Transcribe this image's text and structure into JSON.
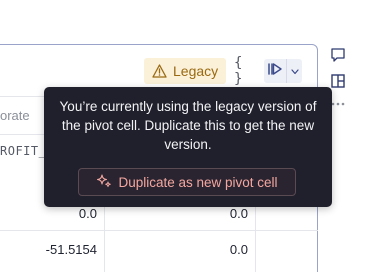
{
  "toolbar": {
    "legacy_label": "Legacy",
    "braces_label": "{ }",
    "icons": {
      "warning": "warning-triangle-icon",
      "braces": "braces-icon",
      "run": "run-icon",
      "chevron": "chevron-down-icon"
    }
  },
  "rail": {
    "icons": [
      "comment-icon",
      "layout-icon",
      "more-icon"
    ]
  },
  "table": {
    "header_fragment": "orate",
    "subheader_fragment": "ROFIT_",
    "rows": [
      {
        "col1": "0.0",
        "col2": "0.0"
      },
      {
        "col1": "-51.5154",
        "col2": "0.0"
      }
    ]
  },
  "tooltip": {
    "message": "You’re currently using the legacy version of the pivot cell. Duplicate this to get the new version.",
    "button_label": "Duplicate as new pivot cell",
    "button_icon": "sparkle-icon"
  },
  "colors": {
    "tooltip_bg": "#1f202b",
    "legacy_bg": "#fbf0d8",
    "legacy_text": "#9a6a12",
    "accent_text": "#f3a7a0",
    "card_border": "#9aa3c9"
  }
}
